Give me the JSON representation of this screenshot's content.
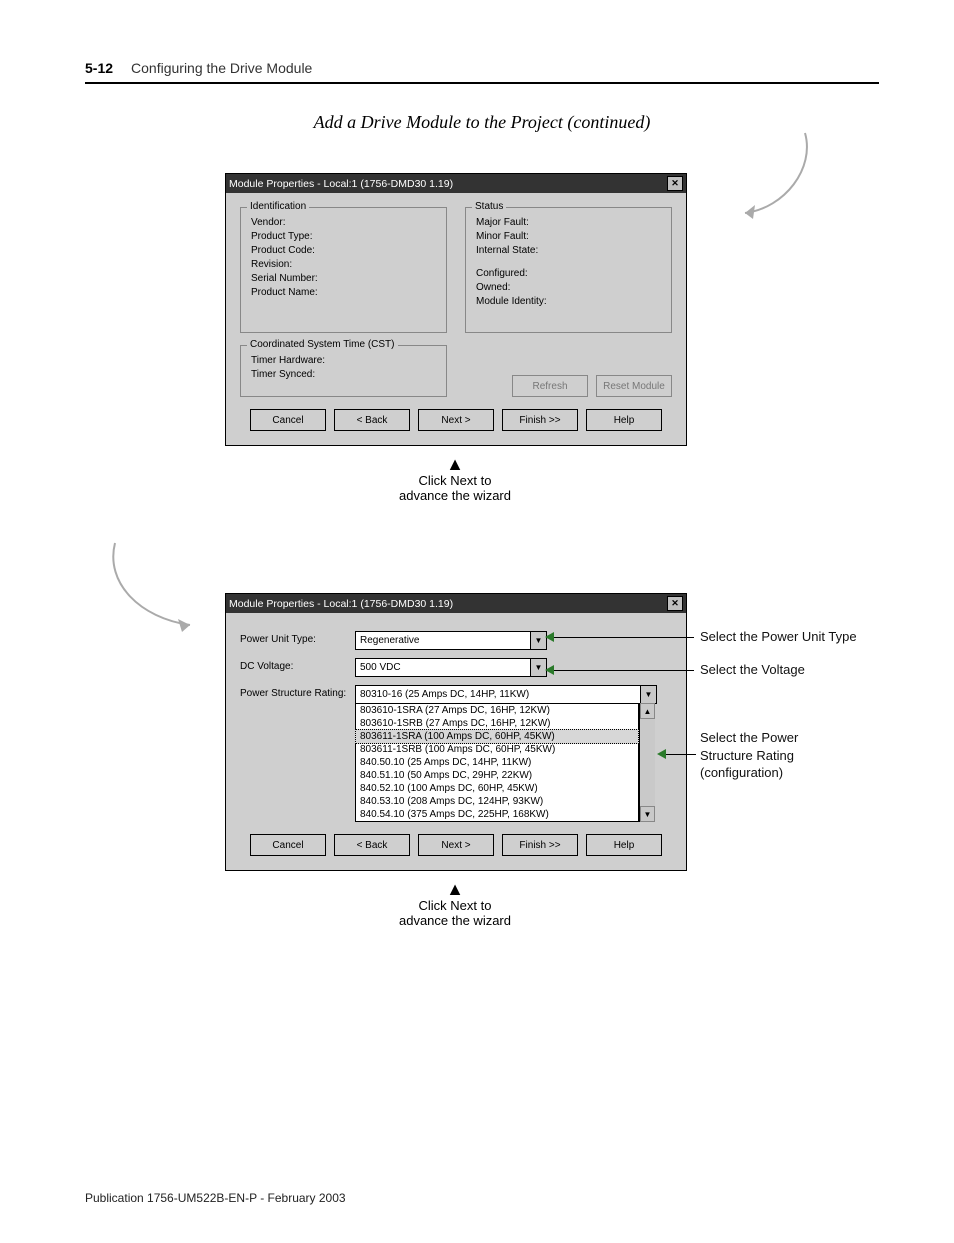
{
  "header": {
    "page": "5-12",
    "chapter": "Configuring the Drive Module"
  },
  "section_title": "Add a Drive Module to the Project (continued)",
  "dlg1": {
    "title": "Module Properties - Local:1 (1756-DMD30 1.19)",
    "close": "✕",
    "ident_title": "Identification",
    "ident": {
      "vendor": "Vendor:",
      "ptype": "Product Type:",
      "pcode": "Product Code:",
      "rev": "Revision:",
      "sn": "Serial Number:",
      "pname": "Product Name:"
    },
    "status_title": "Status",
    "status": {
      "major": "Major Fault:",
      "minor": "Minor Fault:",
      "internal": "Internal State:",
      "configured": "Configured:",
      "owned": "Owned:",
      "modid": "Module Identity:"
    },
    "cst_title": "Coordinated System Time (CST)",
    "cst": {
      "hw": "Timer Hardware:",
      "sync": "Timer Synced:"
    },
    "btn_refresh": "Refresh",
    "btn_reset": "Reset Module",
    "btn_cancel": "Cancel",
    "btn_back": "< Back",
    "btn_next": "Next >",
    "btn_finish": "Finish >>",
    "btn_help": "Help",
    "caption1": "Click Next to",
    "caption2": "advance the wizard"
  },
  "dlg2": {
    "title": "Module Properties - Local:1 (1756-DMD30 1.19)",
    "close": "✕",
    "lab_put": "Power Unit Type:",
    "val_put": "Regenerative",
    "lab_dcv": "DC Voltage:",
    "val_dcv": "500 VDC",
    "lab_psr": "Power Structure Rating:",
    "val_psr": "80310-16 (25 Amps DC, 14HP, 11KW)",
    "opts": [
      "803610-1SRA (27 Amps DC, 16HP, 12KW)",
      "803610-1SRB (27 Amps DC, 16HP, 12KW)",
      "803611-1SRA (100 Amps DC, 60HP, 45KW)",
      "803611-1SRB (100 Amps DC, 60HP, 45KW)",
      "840.50.10 (25 Amps DC, 14HP, 11KW)",
      "840.51.10 (50 Amps DC, 29HP, 22KW)",
      "840.52.10 (100 Amps DC, 60HP, 45KW)",
      "840.53.10 (208 Amps DC, 124HP, 93KW)",
      "840.54.10 (375 Amps DC, 225HP, 168KW)"
    ],
    "btn_cancel": "Cancel",
    "btn_back": "< Back",
    "btn_next": "Next >",
    "btn_finish": "Finish >>",
    "btn_help": "Help",
    "caption1": "Click Next to",
    "caption2": "advance the wizard"
  },
  "ann": {
    "put": "Select the Power Unit Type",
    "volt": "Select the Voltage",
    "psr1": "Select the Power",
    "psr2": "Structure Rating",
    "psr3": "(configuration)"
  },
  "footer": "Publication 1756-UM522B-EN-P - February 2003"
}
